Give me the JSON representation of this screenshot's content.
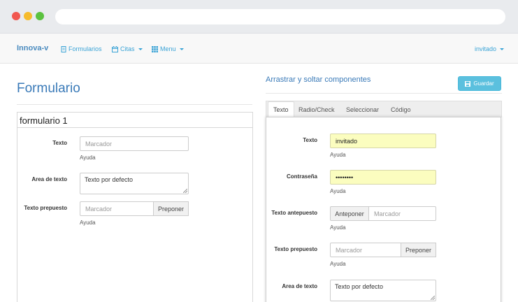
{
  "navbar": {
    "brand": "Innova-v",
    "items": [
      {
        "label": "Formularios",
        "icon": "document-icon"
      },
      {
        "label": "Citas",
        "icon": "calendar-icon"
      },
      {
        "label": "Menu",
        "icon": "grid-icon"
      }
    ],
    "user": "invitado"
  },
  "left": {
    "title": "Formulario",
    "panel_title": "formulario 1",
    "fields": [
      {
        "label": "Texto",
        "placeholder": "Marcador",
        "help": "Ayuda"
      },
      {
        "label": "Area de texto",
        "value": "Texto por defecto"
      },
      {
        "label": "Texto prepuesto",
        "placeholder": "Marcador",
        "addon": "Preponer",
        "help": "Ayuda"
      }
    ]
  },
  "right": {
    "title": "Arrastrar y soltar componentes",
    "save_label": "Guardar",
    "tabs": [
      "Texto",
      "Radio/Check",
      "Seleccionar",
      "Código"
    ],
    "fields": [
      {
        "label": "Texto",
        "value": "invitado",
        "help": "Ayuda"
      },
      {
        "label": "Contraseña",
        "value": "••••••••",
        "help": "Ayuda"
      },
      {
        "label": "Texto antepuesto",
        "addon": "Anteponer",
        "placeholder": "Marcador",
        "help": "Ayuda"
      },
      {
        "label": "Texto prepuesto",
        "placeholder": "Marcador",
        "addon": "Preponer",
        "help": "Ayuda"
      },
      {
        "label": "Area de texto",
        "value": "Texto por defecto"
      }
    ]
  },
  "colors": {
    "accent": "#3aa3d6",
    "title_blue": "#3a7ab8",
    "button_info": "#5bc0de",
    "autofill_yellow": "#fbfdbf"
  }
}
